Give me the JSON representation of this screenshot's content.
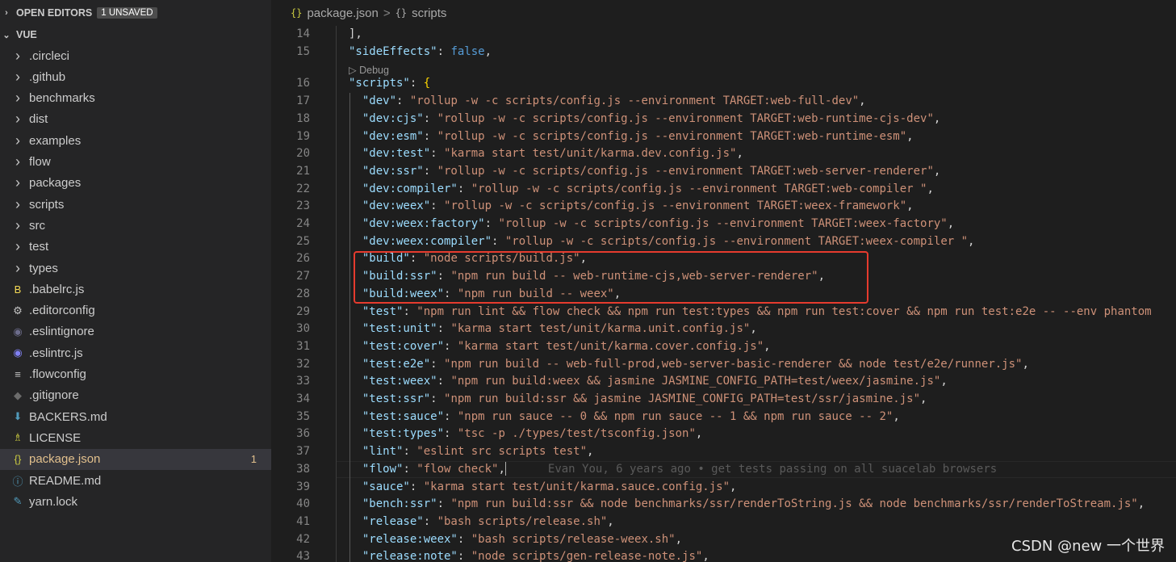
{
  "sidebar": {
    "open_editors_label": "OPEN EDITORS",
    "unsaved_badge": "1 UNSAVED",
    "root_label": "VUE",
    "items": [
      {
        "label": ".circleci",
        "type": "folder"
      },
      {
        "label": ".github",
        "type": "folder"
      },
      {
        "label": "benchmarks",
        "type": "folder"
      },
      {
        "label": "dist",
        "type": "folder"
      },
      {
        "label": "examples",
        "type": "folder"
      },
      {
        "label": "flow",
        "type": "folder"
      },
      {
        "label": "packages",
        "type": "folder"
      },
      {
        "label": "scripts",
        "type": "folder"
      },
      {
        "label": "src",
        "type": "folder"
      },
      {
        "label": "test",
        "type": "folder"
      },
      {
        "label": "types",
        "type": "folder"
      },
      {
        "label": ".babelrc.js",
        "type": "babel-icon",
        "glyph": "B",
        "color": "#f5da55"
      },
      {
        "label": ".editorconfig",
        "type": "gear-icon",
        "glyph": "⚙",
        "color": "#c5c5c5"
      },
      {
        "label": ".eslintignore",
        "type": "eslint-icon",
        "glyph": "◉",
        "color": "#6d6d8c"
      },
      {
        "label": ".eslintrc.js",
        "type": "eslint-icon",
        "glyph": "◉",
        "color": "#8080f2"
      },
      {
        "label": ".flowconfig",
        "type": "lines-icon",
        "glyph": "≡",
        "color": "#c5c5c5"
      },
      {
        "label": ".gitignore",
        "type": "git-icon",
        "glyph": "◆",
        "color": "#6c6c6c"
      },
      {
        "label": "BACKERS.md",
        "type": "markdown-icon",
        "glyph": "⬇",
        "color": "#519aba"
      },
      {
        "label": "LICENSE",
        "type": "license-icon",
        "glyph": "♗",
        "color": "#cbcb41"
      },
      {
        "label": "package.json",
        "type": "json-icon",
        "glyph": "{}",
        "color": "#cbcb41",
        "selected": true,
        "modified": true,
        "count": "1"
      },
      {
        "label": "README.md",
        "type": "info-icon",
        "glyph": "ⓘ",
        "color": "#519aba"
      },
      {
        "label": "yarn.lock",
        "type": "yarn-icon",
        "glyph": "✎",
        "color": "#519aba"
      }
    ]
  },
  "breadcrumb": {
    "file": "package.json",
    "separator": ">",
    "symbol": "scripts",
    "icon_glyph": "{}",
    "symbol_glyph": "{}"
  },
  "codelens": "▷ Debug",
  "blame": "Evan You, 6 years ago • get tests passing on all suacelab browsers",
  "watermark": "CSDN @new 一个世界",
  "lines": [
    {
      "n": "14",
      "pre": "",
      "tokens": [
        {
          "t": "],",
          "c": "pn"
        }
      ]
    },
    {
      "n": "15",
      "pre": "",
      "tokens": [
        {
          "t": "\"sideEffects\"",
          "c": "key"
        },
        {
          "t": ": ",
          "c": "pn"
        },
        {
          "t": "false",
          "c": "kw"
        },
        {
          "t": ",",
          "c": "pn"
        }
      ]
    },
    {
      "n": "16",
      "pre": "",
      "tokens": [
        {
          "t": "\"scripts\"",
          "c": "key"
        },
        {
          "t": ": ",
          "c": "pn"
        },
        {
          "t": "{",
          "c": "br"
        }
      ]
    },
    {
      "n": "17",
      "pre": "  ",
      "key": "\"dev\"",
      "val": "\"rollup -w -c scripts/config.js --environment TARGET:web-full-dev\"",
      "end": ","
    },
    {
      "n": "18",
      "pre": "  ",
      "key": "\"dev:cjs\"",
      "val": "\"rollup -w -c scripts/config.js --environment TARGET:web-runtime-cjs-dev\"",
      "end": ","
    },
    {
      "n": "19",
      "pre": "  ",
      "key": "\"dev:esm\"",
      "val": "\"rollup -w -c scripts/config.js --environment TARGET:web-runtime-esm\"",
      "end": ","
    },
    {
      "n": "20",
      "pre": "  ",
      "key": "\"dev:test\"",
      "val": "\"karma start test/unit/karma.dev.config.js\"",
      "end": ","
    },
    {
      "n": "21",
      "pre": "  ",
      "key": "\"dev:ssr\"",
      "val": "\"rollup -w -c scripts/config.js --environment TARGET:web-server-renderer\"",
      "end": ","
    },
    {
      "n": "22",
      "pre": "  ",
      "key": "\"dev:compiler\"",
      "val": "\"rollup -w -c scripts/config.js --environment TARGET:web-compiler \"",
      "end": ","
    },
    {
      "n": "23",
      "pre": "  ",
      "key": "\"dev:weex\"",
      "val": "\"rollup -w -c scripts/config.js --environment TARGET:weex-framework\"",
      "end": ","
    },
    {
      "n": "24",
      "pre": "  ",
      "key": "\"dev:weex:factory\"",
      "val": "\"rollup -w -c scripts/config.js --environment TARGET:weex-factory\"",
      "end": ","
    },
    {
      "n": "25",
      "pre": "  ",
      "key": "\"dev:weex:compiler\"",
      "val": "\"rollup -w -c scripts/config.js --environment TARGET:weex-compiler \"",
      "end": ","
    },
    {
      "n": "26",
      "pre": "  ",
      "key": "\"build\"",
      "val": "\"node scripts/build.js\"",
      "end": ","
    },
    {
      "n": "27",
      "pre": "  ",
      "key": "\"build:ssr\"",
      "val": "\"npm run build -- web-runtime-cjs,web-server-renderer\"",
      "end": ","
    },
    {
      "n": "28",
      "pre": "  ",
      "key": "\"build:weex\"",
      "val": "\"npm run build -- weex\"",
      "end": ","
    },
    {
      "n": "29",
      "pre": "  ",
      "key": "\"test\"",
      "val": "\"npm run lint && flow check && npm run test:types && npm run test:cover && npm run test:e2e -- --env phantom",
      "end": ""
    },
    {
      "n": "30",
      "pre": "  ",
      "key": "\"test:unit\"",
      "val": "\"karma start test/unit/karma.unit.config.js\"",
      "end": ","
    },
    {
      "n": "31",
      "pre": "  ",
      "key": "\"test:cover\"",
      "val": "\"karma start test/unit/karma.cover.config.js\"",
      "end": ","
    },
    {
      "n": "32",
      "pre": "  ",
      "key": "\"test:e2e\"",
      "val": "\"npm run build -- web-full-prod,web-server-basic-renderer && node test/e2e/runner.js\"",
      "end": ","
    },
    {
      "n": "33",
      "pre": "  ",
      "key": "\"test:weex\"",
      "val": "\"npm run build:weex && jasmine JASMINE_CONFIG_PATH=test/weex/jasmine.js\"",
      "end": ","
    },
    {
      "n": "34",
      "pre": "  ",
      "key": "\"test:ssr\"",
      "val": "\"npm run build:ssr && jasmine JASMINE_CONFIG_PATH=test/ssr/jasmine.js\"",
      "end": ","
    },
    {
      "n": "35",
      "pre": "  ",
      "key": "\"test:sauce\"",
      "val": "\"npm run sauce -- 0 && npm run sauce -- 1 && npm run sauce -- 2\"",
      "end": ","
    },
    {
      "n": "36",
      "pre": "  ",
      "key": "\"test:types\"",
      "val": "\"tsc -p ./types/test/tsconfig.json\"",
      "end": ","
    },
    {
      "n": "37",
      "pre": "  ",
      "key": "\"lint\"",
      "val": "\"eslint src scripts test\"",
      "end": ","
    },
    {
      "n": "38",
      "pre": "  ",
      "key": "\"flow\"",
      "val": "\"flow check\"",
      "end": ",",
      "blame": true
    },
    {
      "n": "39",
      "pre": "  ",
      "key": "\"sauce\"",
      "val": "\"karma start test/unit/karma.sauce.config.js\"",
      "end": ","
    },
    {
      "n": "40",
      "pre": "  ",
      "key": "\"bench:ssr\"",
      "val": "\"npm run build:ssr && node benchmarks/ssr/renderToString.js && node benchmarks/ssr/renderToStream.js\"",
      "end": ","
    },
    {
      "n": "41",
      "pre": "  ",
      "key": "\"release\"",
      "val": "\"bash scripts/release.sh\"",
      "end": ","
    },
    {
      "n": "42",
      "pre": "  ",
      "key": "\"release:weex\"",
      "val": "\"bash scripts/release-weex.sh\"",
      "end": ","
    },
    {
      "n": "43",
      "pre": "  ",
      "key": "\"release:note\"",
      "val": "\"node scripts/gen-release-note.js\"",
      "end": ","
    }
  ]
}
